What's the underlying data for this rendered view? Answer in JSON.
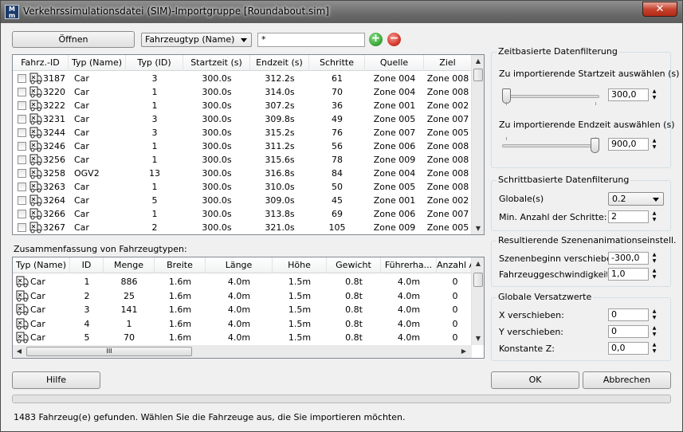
{
  "window": {
    "icon_text": "M m",
    "title": "Verkehrssimulationsdatei (SIM)-Importgruppe [Roundabout.sim]",
    "close_symbol": "✕"
  },
  "toolbar": {
    "open_label": "Öffnen",
    "filter_field": "Fahrzeugtyp (Name)",
    "filter_value": "*",
    "add_icon": "plus-circle-icon",
    "remove_icon": "minus-circle-icon"
  },
  "vehicles": {
    "columns": [
      "Fahrz.-ID",
      "Typ (Name)",
      "Typ (ID)",
      "Startzeit (s)",
      "Endzeit (s)",
      "Schritte",
      "Quelle",
      "Ziel"
    ],
    "rows": [
      [
        "3187",
        "Car",
        "3",
        "300.0s",
        "312.2s",
        "61",
        "Zone 004",
        "Zone 008"
      ],
      [
        "3220",
        "Car",
        "1",
        "300.0s",
        "314.0s",
        "70",
        "Zone 004",
        "Zone 008"
      ],
      [
        "3222",
        "Car",
        "1",
        "300.0s",
        "307.2s",
        "36",
        "Zone 001",
        "Zone 002"
      ],
      [
        "3231",
        "Car",
        "3",
        "300.0s",
        "309.8s",
        "49",
        "Zone 005",
        "Zone 007"
      ],
      [
        "3244",
        "Car",
        "3",
        "300.0s",
        "315.2s",
        "76",
        "Zone 007",
        "Zone 005"
      ],
      [
        "3246",
        "Car",
        "1",
        "300.0s",
        "311.2s",
        "56",
        "Zone 006",
        "Zone 008"
      ],
      [
        "3256",
        "Car",
        "1",
        "300.0s",
        "315.6s",
        "78",
        "Zone 009",
        "Zone 008"
      ],
      [
        "3258",
        "OGV2",
        "13",
        "300.0s",
        "316.8s",
        "84",
        "Zone 004",
        "Zone 008"
      ],
      [
        "3263",
        "Car",
        "1",
        "300.0s",
        "310.0s",
        "50",
        "Zone 005",
        "Zone 008"
      ],
      [
        "3264",
        "Car",
        "5",
        "300.0s",
        "309.0s",
        "45",
        "Zone 001",
        "Zone 002"
      ],
      [
        "3266",
        "Car",
        "1",
        "300.0s",
        "313.8s",
        "69",
        "Zone 006",
        "Zone 007"
      ],
      [
        "3267",
        "Car",
        "2",
        "300.0s",
        "321.0s",
        "105",
        "Zone 009",
        "Zone 005"
      ]
    ]
  },
  "summary": {
    "label": "Zusammenfassung von Fahrzeugtypen:",
    "columns": [
      "Typ (Name)",
      "ID",
      "Menge",
      "Breite",
      "Länge",
      "Höhe",
      "Gewicht",
      "Führerha...",
      "Anzahl An..."
    ],
    "rows": [
      [
        "Car",
        "1",
        "886",
        "1.6m",
        "4.0m",
        "1.5m",
        "0.8t",
        "4.0m",
        "0"
      ],
      [
        "Car",
        "2",
        "25",
        "1.6m",
        "4.0m",
        "1.5m",
        "0.8t",
        "4.0m",
        "0"
      ],
      [
        "Car",
        "3",
        "141",
        "1.6m",
        "4.0m",
        "1.5m",
        "0.8t",
        "4.0m",
        "0"
      ],
      [
        "Car",
        "4",
        "1",
        "1.6m",
        "4.0m",
        "1.5m",
        "0.8t",
        "4.0m",
        "0"
      ],
      [
        "Car",
        "5",
        "70",
        "1.6m",
        "4.0m",
        "1.5m",
        "0.8t",
        "4.0m",
        "0"
      ]
    ],
    "hscroll_grip": "III"
  },
  "time_filter": {
    "title": "Zeitbasierte Datenfilterung",
    "start_label": "Zu importierende Startzeit auswählen (s)",
    "start_value": "300,0",
    "start_slider_fraction": 0.0,
    "end_label": "Zu importierende Endzeit auswählen (s)",
    "end_value": "900,0",
    "end_slider_fraction": 1.0
  },
  "step_filter": {
    "title": "Schrittbasierte Datenfilterung",
    "global_label": "Globale(s)",
    "global_value": "0.2",
    "min_steps_label": "Min. Anzahl der Schritte:",
    "min_steps_value": "2"
  },
  "scene": {
    "title": "Resultierende Szenenanimationseinstell.",
    "start_label": "Szenenbeginn verschieben",
    "start_value": "-300,0",
    "speed_label": "Fahrzeuggeschwindigkeits-M",
    "speed_value": "1,0"
  },
  "offsets": {
    "title": "Globale Versatzwerte",
    "x_label": "X verschieben:",
    "x_value": "0",
    "y_label": "Y verschieben:",
    "y_value": "0",
    "z_label": "Konstante Z:",
    "z_value": "0,0"
  },
  "footer": {
    "help_label": "Hilfe",
    "ok_label": "OK",
    "cancel_label": "Abbrechen",
    "progress_fraction": 0.0,
    "status": "1483 Fahrzeug(e) gefunden. Wählen Sie die Fahrzeuge aus, die Sie importieren möchten."
  },
  "colors": {
    "add_icon": "#3cab3c",
    "remove_icon": "#d63b2f",
    "close_button": "#c7432f"
  }
}
